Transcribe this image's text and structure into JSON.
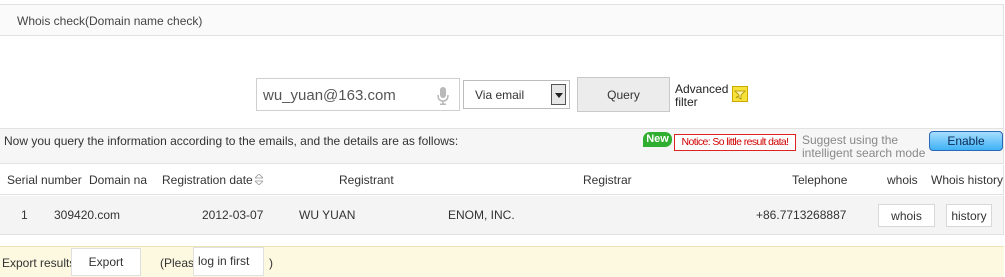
{
  "header": {
    "title": "Whois check(Domain name check)"
  },
  "search": {
    "value": "wu_yuan@163.com",
    "mode_selected": "Via email",
    "query_label": "Query",
    "advanced_filter_line1": "Advanced",
    "advanced_filter_line2": "filter"
  },
  "info_bar": {
    "message": "Now you query the information according to the emails, and the details are as follows:",
    "new_badge": "New",
    "notice": "Notice: So little result data!",
    "suggest_line1": "Suggest using the",
    "suggest_line2": "intelligent search mode",
    "enable_label": "Enable"
  },
  "table": {
    "columns": {
      "serial": "Serial number",
      "domain": "Domain na",
      "registration_date": "Registration date",
      "registrant": "Registrant",
      "registrar": "Registrar",
      "telephone": "Telephone",
      "whois": "whois",
      "history": "Whois history"
    },
    "rows": [
      {
        "serial": "1",
        "domain": "309420.com",
        "registration_date": "2012-03-07",
        "registrant": "WU YUAN",
        "registrar": "ENOM, INC.",
        "telephone": "+86.7713268887",
        "whois_btn": "whois",
        "history_btn": "history"
      }
    ]
  },
  "export": {
    "label": "Export results",
    "button": "Export",
    "note_prefix": "(Please",
    "login_link": "log in first",
    "note_suffix": ")"
  },
  "colors": {
    "notice_red": "#d00000",
    "new_green": "#2fae2f",
    "enable_blue": "#3fb2f5",
    "export_bg": "#fdf8e0"
  },
  "icons": [
    "microphone-icon",
    "filter-icon",
    "sort-icon"
  ]
}
